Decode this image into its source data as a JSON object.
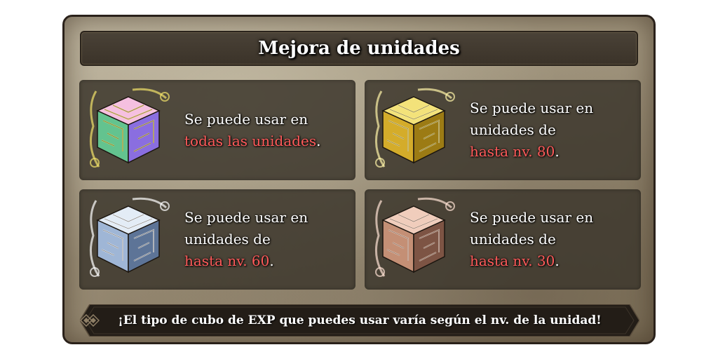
{
  "title": "Mejora de unidades",
  "cards": [
    {
      "cube": "rainbow-exp-cube",
      "colors": {
        "top": "#f5c0e0",
        "left": "#63c38f",
        "right": "#8a6ee0",
        "accent": "#f2e36a"
      },
      "line1": "Se puede usar en",
      "line2": "",
      "highlight": "todas las unidades",
      "tail": "."
    },
    {
      "cube": "gold-exp-cube",
      "colors": {
        "top": "#f3e27a",
        "left": "#d4ac2a",
        "right": "#9c7b14",
        "accent": "#fff3a8"
      },
      "line1": "Se puede usar en",
      "line2": "unidades de",
      "highlight": "hasta nv. 80",
      "tail": "."
    },
    {
      "cube": "silver-exp-cube",
      "colors": {
        "top": "#e3ecf6",
        "left": "#9fb6d6",
        "right": "#5d7497",
        "accent": "#ffffff"
      },
      "line1": "Se puede usar en",
      "line2": "unidades de",
      "highlight": "hasta nv. 60",
      "tail": "."
    },
    {
      "cube": "bronze-exp-cube",
      "colors": {
        "top": "#f0cdbc",
        "left": "#c48f75",
        "right": "#7d5444",
        "accent": "#ffe3d4"
      },
      "line1": "Se puede usar en",
      "line2": "unidades de",
      "highlight": "hasta nv. 30",
      "tail": "."
    }
  ],
  "footer": "¡El tipo de cubo de EXP que puedes usar varía según el nv. de la unidad!",
  "theme": {
    "highlight": "#ff5a5a",
    "card_bg": "#3e382d",
    "panel_border": "#2a211a"
  }
}
